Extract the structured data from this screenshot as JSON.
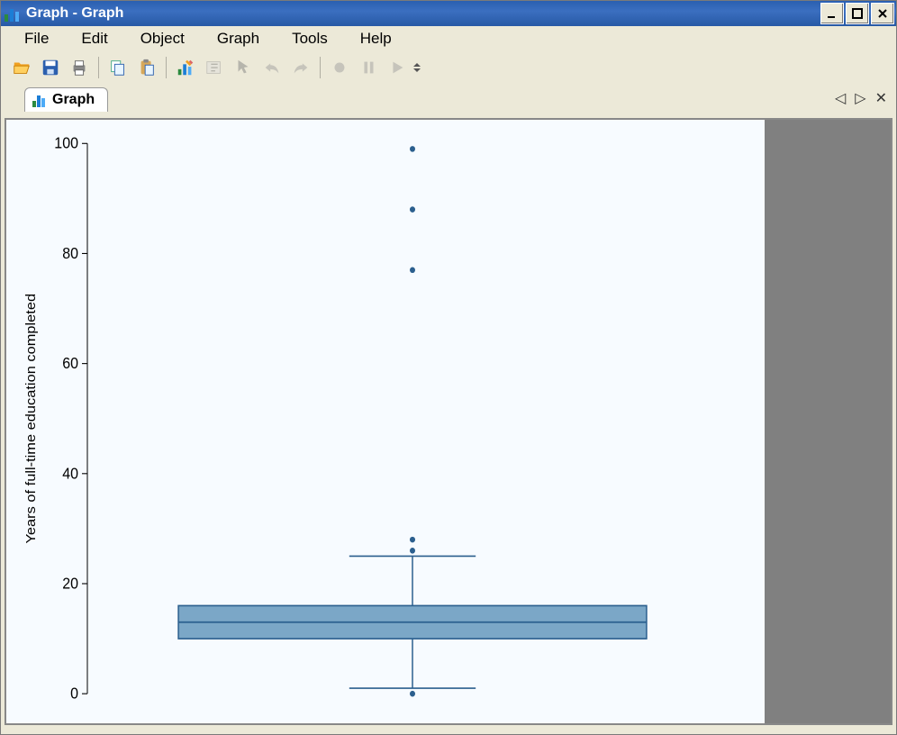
{
  "window": {
    "title": "Graph - Graph"
  },
  "menu": {
    "file": "File",
    "edit": "Edit",
    "object": "Object",
    "graph": "Graph",
    "tools": "Tools",
    "help": "Help"
  },
  "tab": {
    "label": "Graph"
  },
  "toolbar": {
    "open": "open",
    "save": "save",
    "print": "print",
    "copy": "copy",
    "paste": "paste",
    "edit": "edit-graph",
    "rename": "rename",
    "pointer": "pointer",
    "undo": "undo",
    "redo": "redo",
    "record": "record",
    "pause": "pause",
    "play": "play"
  },
  "chart_data": {
    "type": "boxplot",
    "ylabel": "Years of full-time education completed",
    "ylim": [
      0,
      100
    ],
    "yticks": [
      0,
      20,
      40,
      60,
      80,
      100
    ],
    "box": {
      "q1": 10,
      "median": 13,
      "q3": 16,
      "whisker_low": 1,
      "whisker_high": 25
    },
    "outliers": [
      0,
      26,
      28,
      77,
      88,
      99
    ]
  }
}
